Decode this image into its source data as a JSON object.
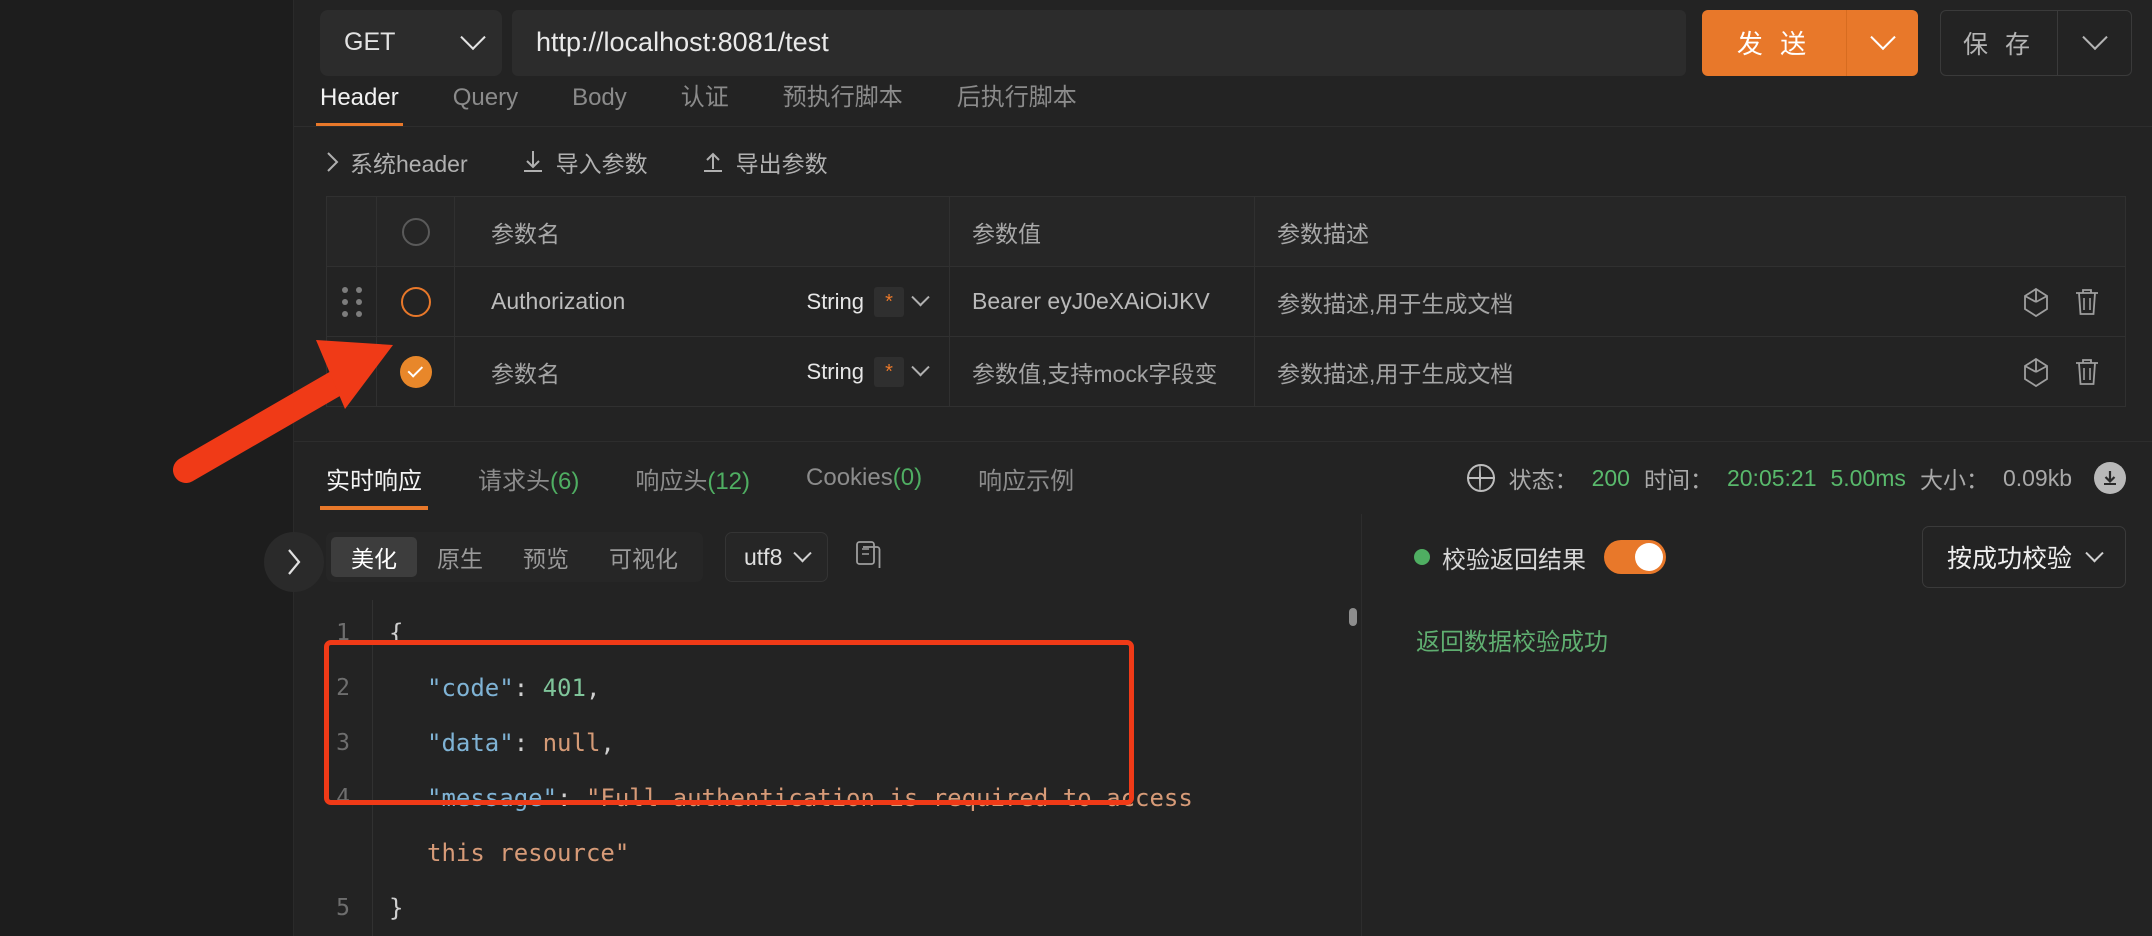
{
  "request": {
    "method": "GET",
    "method_icon": "chevron-down-icon",
    "url": "http://localhost:8081/test",
    "send_label": "发 送",
    "save_label": "保 存"
  },
  "req_tabs": [
    {
      "label": "Header",
      "active": true
    },
    {
      "label": "Query",
      "active": false
    },
    {
      "label": "Body",
      "active": false
    },
    {
      "label": "认证",
      "active": false
    },
    {
      "label": "预执行脚本",
      "active": false
    },
    {
      "label": "后执行脚本",
      "active": false
    }
  ],
  "param_toolbar": [
    {
      "label": "系统header",
      "icon": "chevron-right-icon"
    },
    {
      "label": "导入参数",
      "icon": "import-download-icon"
    },
    {
      "label": "导出参数",
      "icon": "export-upload-icon"
    }
  ],
  "table": {
    "headers": {
      "name": "参数名",
      "value": "参数值",
      "desc": "参数描述"
    },
    "rows": [
      {
        "checked": false,
        "name": "Authorization",
        "name_filled": true,
        "type": "String",
        "required_mark": "*",
        "value": "Bearer eyJ0eXAiOiJKV",
        "value_filled": true,
        "desc": "参数描述,用于生成文档",
        "icons": [
          "box-3d-icon",
          "trash-icon"
        ]
      },
      {
        "checked": true,
        "name": "参数名",
        "name_filled": false,
        "type": "String",
        "required_mark": "*",
        "value": "参数值,支持mock字段变",
        "value_filled": false,
        "desc": "参数描述,用于生成文档",
        "icons": [
          "box-3d-icon",
          "trash-icon"
        ]
      }
    ]
  },
  "response": {
    "tabs": [
      {
        "label": "实时响应",
        "count": "",
        "active": true
      },
      {
        "label": "请求头",
        "count": "(6)",
        "active": false
      },
      {
        "label": "响应头",
        "count": "(12)",
        "active": false
      },
      {
        "label": "Cookies",
        "count": "(0)",
        "active": false
      },
      {
        "label": "响应示例",
        "count": "",
        "active": false
      }
    ],
    "status": {
      "globe_icon": "globe-icon",
      "status_label": "状态：",
      "status_value": "200",
      "time_label": "时间：",
      "time_value": "20:05:21",
      "duration_value": "5.00ms",
      "size_label": "大小：",
      "size_value": "0.09kb",
      "download_icon": "download-icon"
    },
    "format_tabs": [
      {
        "label": "美化",
        "active": true
      },
      {
        "label": "原生",
        "active": false
      },
      {
        "label": "预览",
        "active": false
      },
      {
        "label": "可视化",
        "active": false
      }
    ],
    "encoding": "utf8",
    "copy_icon": "copy-icon",
    "code": {
      "line_numbers": [
        "1",
        "2",
        "3",
        "4",
        "5"
      ],
      "lines": [
        {
          "text": "{",
          "type": "plain"
        },
        {
          "key": "\"code\"",
          "sep": ": ",
          "val": "401",
          "val_type": "num",
          "tail": ","
        },
        {
          "key": "\"data\"",
          "sep": ": ",
          "val": "null",
          "val_type": "null",
          "tail": ","
        },
        {
          "key": "\"message\"",
          "sep": ": ",
          "val": "\"Full authentication is required to access",
          "val_type": "str",
          "tail": ""
        },
        {
          "text": "this resource\"",
          "type": "str-cont"
        },
        {
          "text": "}",
          "type": "plain"
        }
      ]
    },
    "validation": {
      "collapse_icon": "chevron-right-icon",
      "label": "校验返回结果",
      "toggle_on": true,
      "mode": "按成功校验",
      "message": "返回数据校验成功"
    }
  },
  "colors": {
    "accent": "#e8782a",
    "success": "#4fae62",
    "annotation": "#f03a17",
    "bg": "#232323"
  }
}
